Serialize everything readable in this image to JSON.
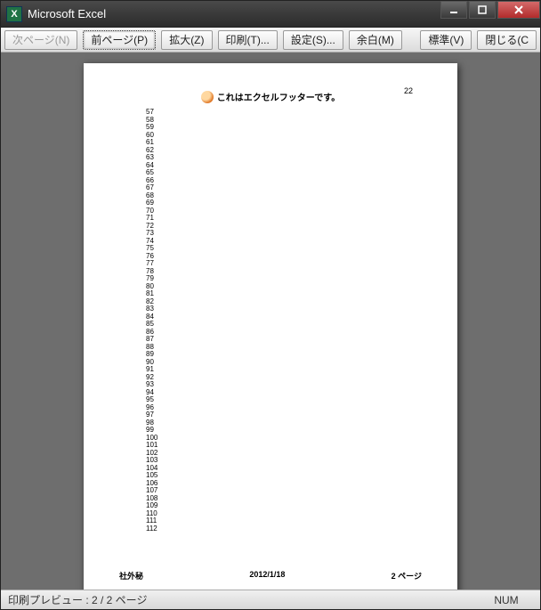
{
  "window": {
    "title": "Microsoft Excel"
  },
  "toolbar": {
    "next_page": "次ページ(N)",
    "prev_page": "前ページ(P)",
    "zoom": "拡大(Z)",
    "print": "印刷(T)...",
    "setup": "設定(S)...",
    "margins": "余白(M)",
    "normal": "標準(V)",
    "close": "閉じる(C"
  },
  "page": {
    "page_number_top": "22",
    "header_text": "これはエクセルフッターです。",
    "row_start": 57,
    "row_end": 112,
    "footer_left": "社外秘",
    "footer_center": "2012/1/18",
    "footer_right": "2 ページ"
  },
  "statusbar": {
    "text": "印刷プレビュー : 2 / 2 ページ",
    "indicator": "NUM"
  }
}
